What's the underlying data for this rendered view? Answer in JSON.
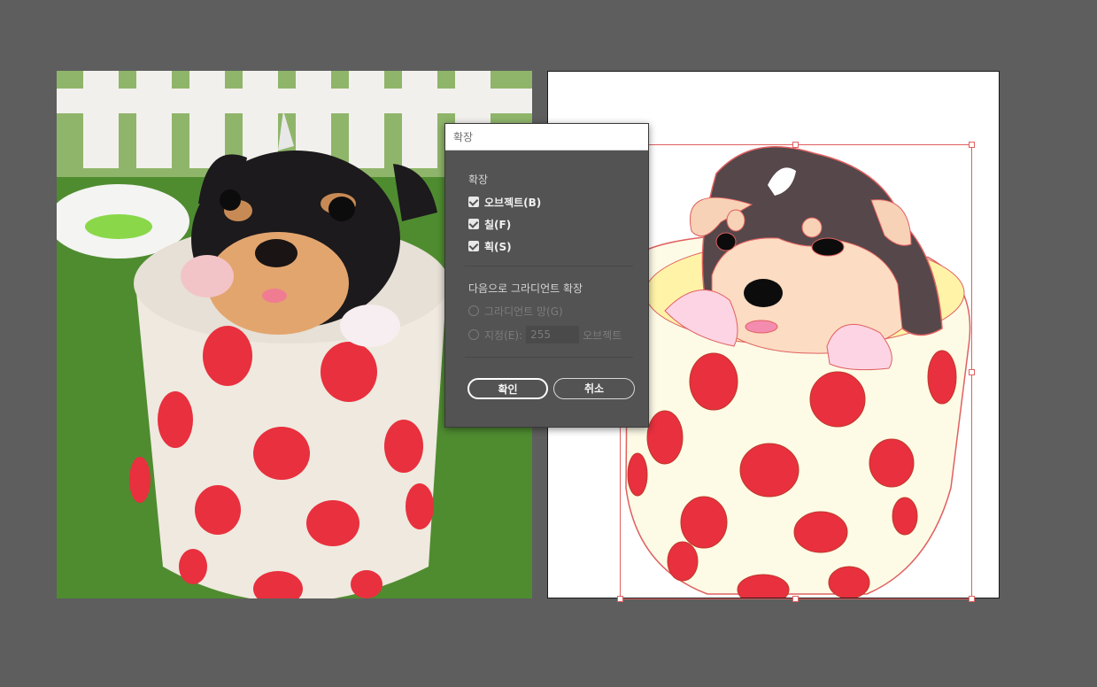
{
  "dialog": {
    "title": "확장",
    "expand_section": {
      "label": "확장",
      "options": [
        {
          "label": "오브젝트(B)",
          "checked": true
        },
        {
          "label": "칠(F)",
          "checked": true
        },
        {
          "label": "획(S)",
          "checked": true
        }
      ]
    },
    "gradient_section": {
      "label": "다음으로 그라디언트 확장",
      "mesh_label": "그라디언트 망(G)",
      "specify_label": "지정(E):",
      "specify_value": "255",
      "objects_label": "오브젝트"
    },
    "ok_label": "확인",
    "cancel_label": "취소"
  },
  "colors": {
    "workspace": "#5e5e5e",
    "dialog_bg": "#535353",
    "selection": "#e06060",
    "dot_red": "#e8303e"
  }
}
